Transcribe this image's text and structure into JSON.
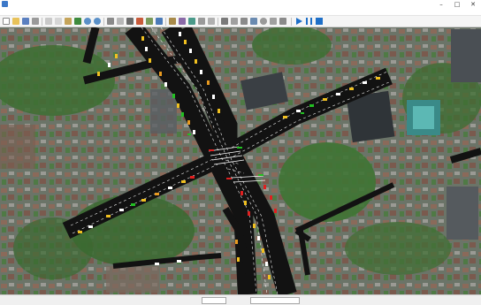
{
  "window": {
    "title": "",
    "minimize_glyph": "–",
    "maximize_glyph": "□",
    "close_glyph": "✕"
  },
  "menu": {
    "items": [
      "",
      "",
      "",
      "",
      "",
      "",
      "",
      "",
      "",
      "",
      ""
    ]
  },
  "toolbar": {
    "icons": [
      "new-icon",
      "open-icon",
      "save-icon",
      "print-icon",
      "cut-icon",
      "copy-icon",
      "paste-icon",
      "undo-icon",
      "zoom-in-icon",
      "zoom-out-icon",
      "pan-icon",
      "select-icon",
      "road-icon",
      "signal-icon",
      "detector-icon",
      "vehicle-icon",
      "route-icon",
      "settings-icon",
      "chart-icon",
      "play-icon",
      "pause-icon",
      "stop-icon"
    ]
  },
  "status": {
    "left_text": "",
    "sim_time_label": "",
    "sim_time_value": "",
    "real_time_label": "",
    "real_time_value": "",
    "right_text": ""
  },
  "colors": {
    "accent": "#1e6fc8",
    "road": "#1a1a1a",
    "vegetation": "#3d6e32",
    "signal_red": "#e02020",
    "signal_green": "#22c022",
    "vehicle_yellow": "#f0c020",
    "vehicle_orange": "#e89a20"
  }
}
